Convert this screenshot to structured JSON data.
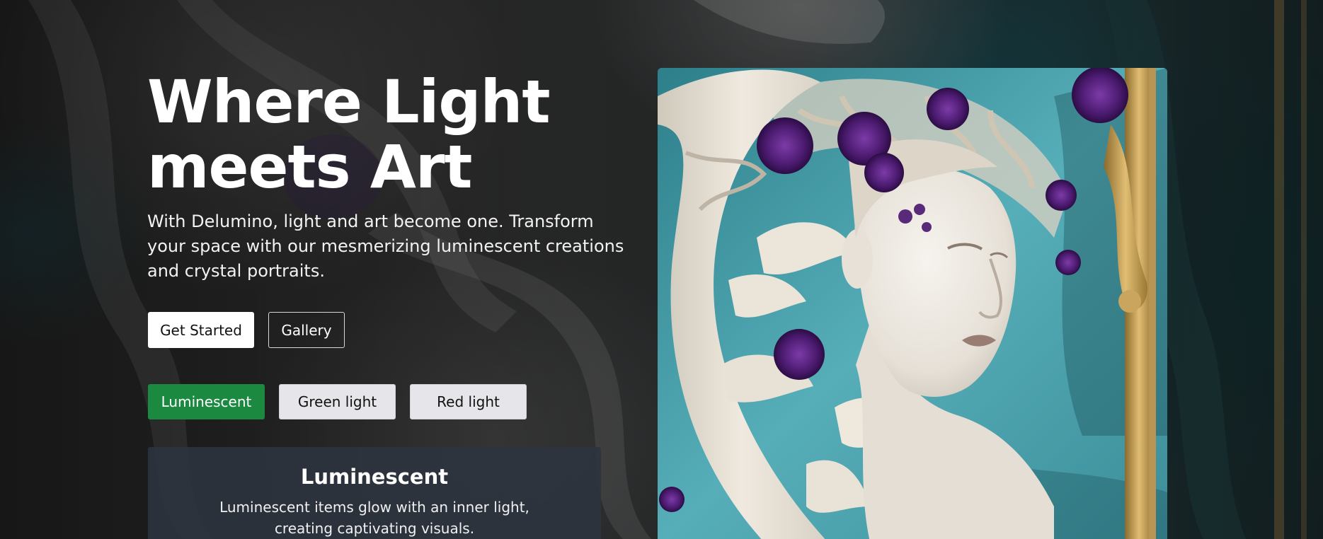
{
  "hero": {
    "title_line1": "Where Light",
    "title_line2": "meets Art",
    "description": "With Delumino, light and art become one. Transform your space with our mesmerizing luminescent creations and crystal portraits."
  },
  "actions": {
    "get_started_label": "Get Started",
    "gallery_label": "Gallery"
  },
  "modes": {
    "items": [
      {
        "label": "Luminescent",
        "active": true
      },
      {
        "label": "Green light",
        "active": false
      },
      {
        "label": "Red light",
        "active": false
      }
    ],
    "active_color": "#1b8a40"
  },
  "info_card": {
    "title": "Luminescent",
    "text": "Luminescent items glow with an inner light, creating captivating visuals."
  },
  "artwork": {
    "subject": "sculpted woman portrait with purple flowers, teal background, gold frame",
    "colors": {
      "ivory": "#e9e2d6",
      "teal": "#4aa3ad",
      "purple": "#4a1a6e",
      "gold": "#c9a25a"
    }
  }
}
